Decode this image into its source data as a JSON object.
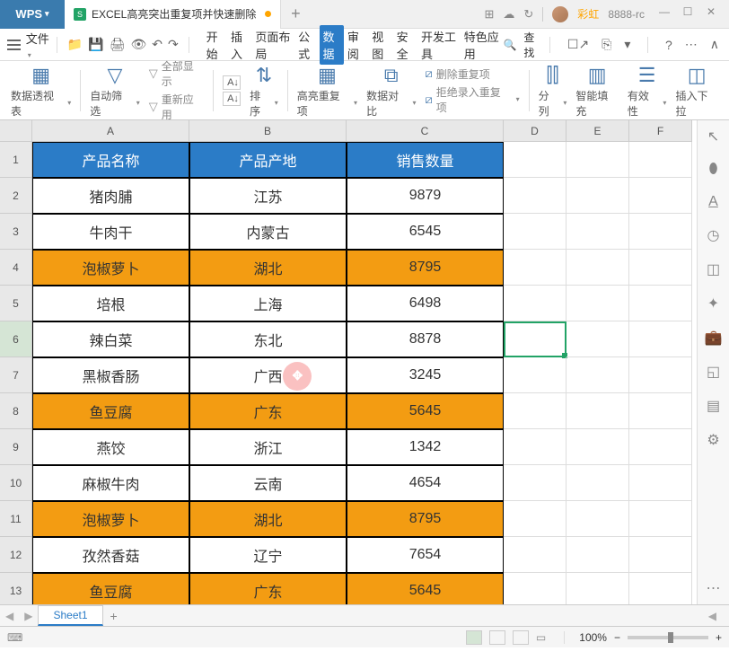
{
  "app": {
    "logo": "WPS",
    "tab_title": "EXCEL高亮突出重复项并快速删除",
    "add_tab": "+"
  },
  "user": {
    "name": "彩虹",
    "id": "8888-rc"
  },
  "window": {
    "min": "—",
    "max": "☐",
    "close": "✕"
  },
  "titlebar_icons": {
    "grid": "⊞",
    "cloud": "☁",
    "refresh": "↻"
  },
  "menubar": {
    "file": "文件",
    "tabs": [
      "开始",
      "插入",
      "页面布局",
      "公式",
      "数据",
      "审阅",
      "视图",
      "安全",
      "开发工具",
      "特色应用"
    ],
    "active_idx": 4,
    "search": "查找"
  },
  "ribbon": {
    "pivot": "数据透视表",
    "filter": "自动筛选",
    "show_all": "全部显示",
    "reapply": "重新应用",
    "sort_asc": "A↓",
    "sort_desc": "A↓",
    "sort_label": "排序",
    "highlight_dup": "高亮重复项",
    "data_compare": "数据对比",
    "del_dup": "删除重复项",
    "reject_dup": "拒绝录入重复项",
    "split_col": "分列",
    "smart_fill": "智能填充",
    "validity": "有效性",
    "insert_dd": "插入下拉"
  },
  "namebox": "D6",
  "columns": [
    "A",
    "B",
    "C",
    "D",
    "E",
    "F"
  ],
  "table": {
    "headers": [
      "产品名称",
      "产品产地",
      "销售数量"
    ],
    "rows": [
      {
        "r": 2,
        "c": [
          "猪肉脯",
          "江苏",
          "9879"
        ],
        "hl": false
      },
      {
        "r": 3,
        "c": [
          "牛肉干",
          "内蒙古",
          "6545"
        ],
        "hl": false
      },
      {
        "r": 4,
        "c": [
          "泡椒萝卜",
          "湖北",
          "8795"
        ],
        "hl": true
      },
      {
        "r": 5,
        "c": [
          "培根",
          "上海",
          "6498"
        ],
        "hl": false
      },
      {
        "r": 6,
        "c": [
          "辣白菜",
          "东北",
          "8878"
        ],
        "hl": false
      },
      {
        "r": 7,
        "c": [
          "黑椒香肠",
          "广西",
          "3245"
        ],
        "hl": false
      },
      {
        "r": 8,
        "c": [
          "鱼豆腐",
          "广东",
          "5645"
        ],
        "hl": true
      },
      {
        "r": 9,
        "c": [
          "燕饺",
          "浙江",
          "1342"
        ],
        "hl": false
      },
      {
        "r": 10,
        "c": [
          "麻椒牛肉",
          "云南",
          "4654"
        ],
        "hl": false
      },
      {
        "r": 11,
        "c": [
          "泡椒萝卜",
          "湖北",
          "8795"
        ],
        "hl": true
      },
      {
        "r": 12,
        "c": [
          "孜然香菇",
          "辽宁",
          "7654"
        ],
        "hl": false
      },
      {
        "r": 13,
        "c": [
          "鱼豆腐",
          "广东",
          "5645"
        ],
        "hl": true
      }
    ]
  },
  "selected_row": 6,
  "cursor": {
    "row": 7,
    "col": "B"
  },
  "sheet": {
    "name": "Sheet1",
    "add": "+"
  },
  "statusbar": {
    "zoom": "100%",
    "zoom_minus": "−",
    "zoom_plus": "+"
  }
}
